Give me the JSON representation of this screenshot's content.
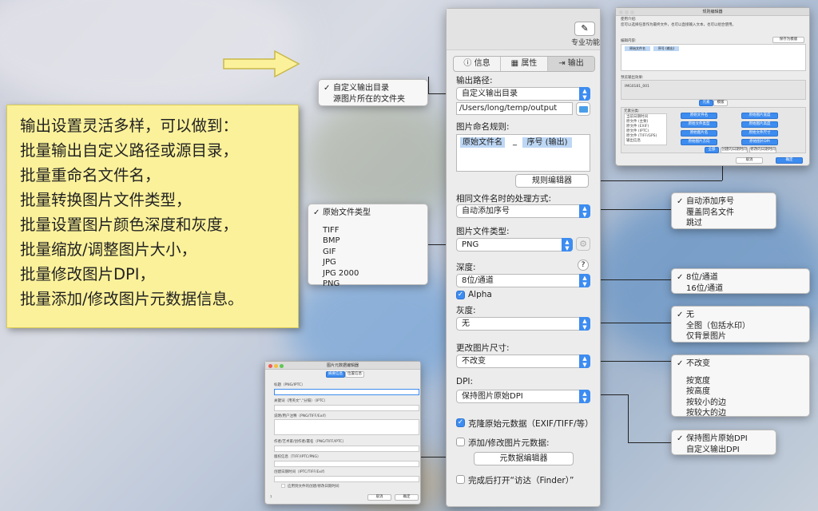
{
  "callout": {
    "lines": [
      "输出设置灵活多样，可以做到：",
      "批量输出自定义路径或源目录，",
      "批量重命名文件名，",
      "批量转换图片文件类型，",
      "批量设置图片颜色深度和灰度，",
      "批量缩放/调整图片大小，",
      "批量修改图片DPI，",
      "批量添加/修改图片元数据信息。"
    ]
  },
  "panel": {
    "pro_label": "专业功能",
    "tabs": [
      "信息",
      "属性",
      "输出"
    ],
    "output_path_label": "输出路径:",
    "output_path_value": "自定义输出目录",
    "path_text": "/Users/long/temp/output",
    "naming_label": "图片命名规则:",
    "token1": "原始文件名",
    "token_sep": "_",
    "token2": "序号 (输出)",
    "rule_editor_btn": "规则编辑器",
    "same_name_label": "相同文件名时的处理方式:",
    "same_name_value": "自动添加序号",
    "filetype_label": "图片文件类型:",
    "filetype_value": "PNG",
    "depth_label": "深度:",
    "depth_value": "8位/通道",
    "alpha_label": "Alpha",
    "gray_label": "灰度:",
    "gray_value": "无",
    "resize_label": "更改图片尺寸:",
    "resize_value": "不改变",
    "dpi_label": "DPI:",
    "dpi_value": "保持图片原始DPI",
    "clone_meta_label": "克隆原始元数据（EXIF/TIFF/等）",
    "add_meta_label": "添加/修改图片元数据:",
    "meta_editor_btn": "元数据编辑器",
    "open_finder_label": "完成后打开“访达（Finder）”"
  },
  "popups": {
    "output": [
      "自定义输出目录",
      "源图片所在的文件夹"
    ],
    "filetype_selected": "原始文件类型",
    "filetype_options": [
      "TIFF",
      "BMP",
      "GIF",
      "JPG",
      "JPG 2000",
      "PNG"
    ],
    "samename": [
      "自动添加序号",
      "覆盖同名文件",
      "跳过"
    ],
    "depth": [
      "8位/通道",
      "16位/通道"
    ],
    "gray": [
      "无",
      "全图（包括水印）",
      "仅背景图片"
    ],
    "resize_selected": "不改变",
    "resize_options": [
      "按宽度",
      "按高度",
      "按较小的边",
      "按较大的边"
    ],
    "dpi": [
      "保持图片原始DPI",
      "自定义输出DPI"
    ]
  },
  "meta_editor": {
    "title": "图片元数据编辑器",
    "tab1": "摘要信息",
    "tab2": "位置信息",
    "f1": "标题（PNG/IPTC）",
    "f2": "关键词（用英文\",\"分隔）（IPTC）",
    "f3": "说明/用户注释（PNG/TIFF/Exif）",
    "f4": "作者/艺术家/创作者/署名（PNG/TIFF/IPTC）",
    "f5": "版权信息（TIFF/IPTC/PNG）",
    "f6": "创建日期时间（IPTC/TIFF/Exif）",
    "apply_label": "应用到文件的创建/修改日期时间",
    "help": "?",
    "cancel": "取消",
    "ok": "确定"
  },
  "rule_editor": {
    "title": "规则编辑器",
    "desc_label": "使用介绍:",
    "desc": "您可以选择任意作为最终文件，也可以直接输入文本，也可以组合使用。",
    "save_template": "保存为模版",
    "edit_label": "编辑内容:",
    "tok1": "原始文件名",
    "tok2": "序号 (输出)",
    "preview_label": "预览输出效果:",
    "preview_value": "IMG0181_001",
    "tab1": "元素",
    "tab2": "模版",
    "list_label": "元素分类:",
    "list": [
      "当前日期时间",
      "原文件 (主要)",
      "原文件 (EXIF)",
      "原文件 (IPTC)",
      "原文件 (TIFF/GPS)",
      "输出信息"
    ],
    "grid": [
      "原始文件名",
      "原始图片宽度",
      "原始文件类型",
      "原始图片高度",
      "原始图片名",
      "原始文件尺寸",
      "原始图片方向",
      "原始图片DPI"
    ],
    "b1": "全部",
    "b2": "创建的日期时间",
    "b3": "修改的日期时间",
    "cancel": "取消",
    "ok": "确定"
  }
}
